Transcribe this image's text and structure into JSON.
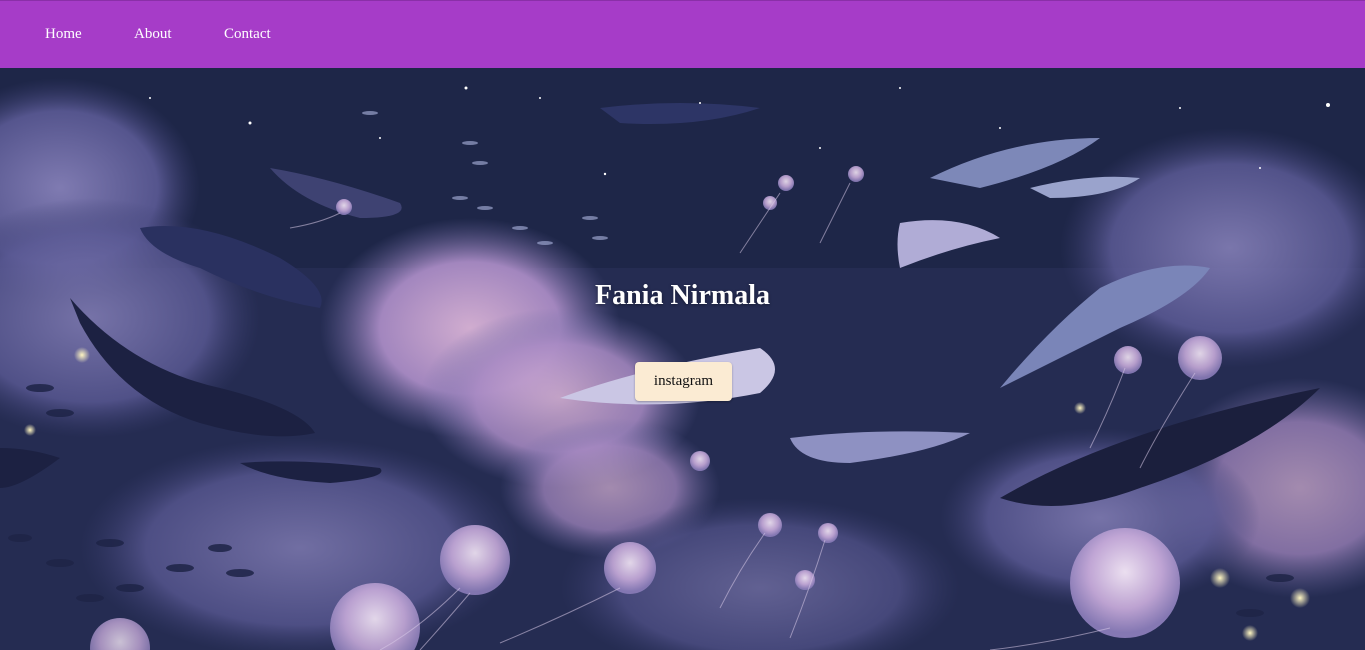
{
  "nav": {
    "items": [
      {
        "label": "Home"
      },
      {
        "label": "About"
      },
      {
        "label": "Contact"
      }
    ],
    "background_color": "#a63cc8"
  },
  "hero": {
    "title": "Fania Nirmala",
    "button_label": "instagram",
    "button_color": "#fbebd3",
    "background_description_icon": "whales-jellyfish-sky-illustration"
  }
}
